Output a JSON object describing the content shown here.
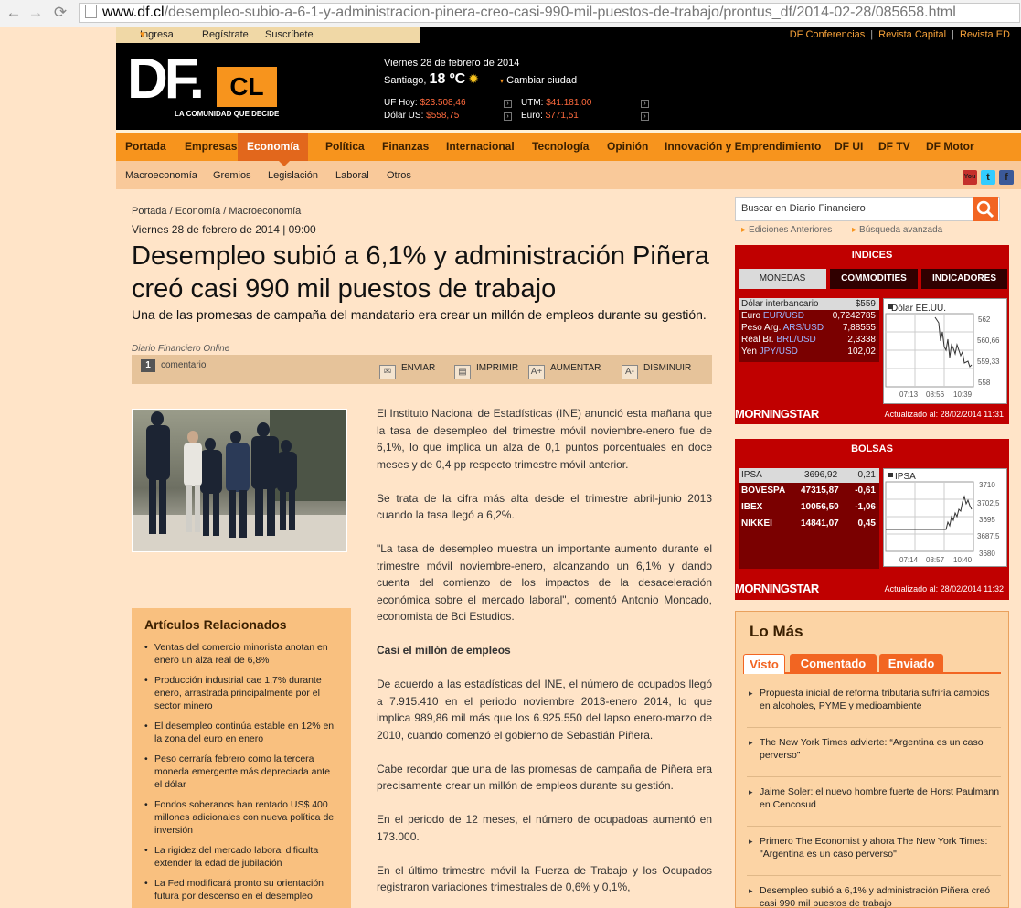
{
  "browser": {
    "url_host": "www.df.cl",
    "url_path": "/desempleo-subio-a-6-1-y-administracion-pinera-creo-casi-990-mil-puestos-de-trabajo/prontus_df/2014-02-28/085658.html"
  },
  "user_links": {
    "login": "Ingresa",
    "register": "Regístrate",
    "subscribe": "Suscríbete"
  },
  "top_links": [
    "DF Conferencias",
    "Revista Capital",
    "Revista ED"
  ],
  "logo": {
    "df": "DF.",
    "cl": "CL",
    "tagline": "LA COMUNIDAD QUE DECIDE"
  },
  "header": {
    "date": "Viernes 28 de febrero de 2014",
    "city": "Santiago,",
    "temp": "18 ºC",
    "change_city": "Cambiar ciudad",
    "uf_label": "UF Hoy:",
    "uf_value": "$23.508,46",
    "dolar_label": "Dólar US:",
    "dolar_value": "$558,75",
    "utm_label": "UTM:",
    "utm_value": "$41.181,00",
    "euro_label": "Euro:",
    "euro_value": "$771,51"
  },
  "nav": {
    "items": [
      "Portada",
      "Empresas",
      "Economía",
      "Política",
      "Finanzas",
      "Internacional",
      "Tecnología",
      "Opinión",
      "Innovación y Emprendimiento",
      "DF UI",
      "DF TV",
      "DF Motor"
    ],
    "active": "Economía"
  },
  "subnav": [
    "Macroeconomía",
    "Gremios",
    "Legislación",
    "Laboral",
    "Otros"
  ],
  "social": {
    "youtube": "You",
    "twitter": "t",
    "facebook": "f"
  },
  "article": {
    "breadcrumb": "Portada / Economía / Macroeconomía",
    "dateline": "Viernes 28 de febrero de 2014 | 09:00",
    "headline": "Desempleo subió a 6,1% y administración Piñera creó casi 990 mil puestos de trabajo",
    "lead": "Una de las promesas de campaña del mandatario era crear un millón de empleos durante su gestión.",
    "source": "Diario Financiero Online",
    "comment_count": "1",
    "comment_label": "comentario",
    "tools": {
      "send": "ENVIAR",
      "print": "IMPRIMIR",
      "bigger": "AUMENTAR",
      "smaller": "DISMINUIR"
    },
    "paragraphs": [
      "El Instituto Nacional de Estadísticas (INE) anunció esta mañana que la tasa de desempleo del trimestre móvil noviembre-enero fue de 6,1%, lo que implica un alza de 0,1 puntos porcentuales en doce meses y de 0,4 pp respecto trimestre móvil anterior.",
      "Se trata de la cifra más alta desde el trimestre abril-junio 2013 cuando la tasa llegó a 6,2%.",
      "\"La tasa de desempleo muestra un importante aumento durante el trimestre móvil noviembre-enero, alcanzando un 6,1% y dando cuenta del comienzo de los impactos de la desaceleración económica sobre el mercado laboral\", comentó Antonio Moncado, economista de Bci Estudios.",
      "Casi el millón de empleos",
      "De acuerdo a las estadísticas del INE, el número de ocupados llegó a 7.915.410 en el periodo noviembre 2013-enero 2014, lo que implica 989,86 mil más que los 6.925.550 del lapso enero-marzo de 2010, cuando comenzó el gobierno de Sebastián Piñera.",
      "Cabe recordar que una de las promesas de campaña de Piñera era precisamente crear un millón de empleos durante su gestión.",
      "En el periodo de 12 meses, el número de ocupadoas aumentó en 173.000.",
      "En el último trimestre móvil la Fuerza de Trabajo y los Ocupados registraron variaciones trimestrales de 0,6% y 0,1%,"
    ]
  },
  "related": {
    "title": "Artículos Relacionados",
    "items": [
      "Ventas del comercio minorista anotan en enero un alza real de 6,8%",
      "Producción industrial cae 1,7% durante enero, arrastrada principalmente por el sector minero",
      "El desempleo continúa estable en 12% en la zona del euro en enero",
      "Peso cerraría febrero como la tercera moneda emergente más depreciada ante el dólar",
      "Fondos soberanos han rentado US$ 400 millones adicionales con nueva política de inversión",
      "La rigidez del mercado laboral dificulta extender la edad de jubilación",
      "La Fed modificará pronto su orientación futura por descenso en el desempleo"
    ]
  },
  "search": {
    "placeholder": "Buscar en Diario Financiero",
    "past": "Ediciones Anteriores",
    "advanced": "Búsqueda avanzada"
  },
  "indices": {
    "title": "INDICES",
    "tabs": [
      "MONEDAS",
      "COMMODITIES",
      "INDICADORES"
    ],
    "rows": [
      {
        "name": "Dólar interbancario",
        "pair": "",
        "value": "$559"
      },
      {
        "name": "Euro",
        "pair": "EUR/USD",
        "value": "0,7242785"
      },
      {
        "name": "Peso Arg.",
        "pair": "ARS/USD",
        "value": "7,88555"
      },
      {
        "name": "Real Br.",
        "pair": "BRL/USD",
        "value": "2,3338"
      },
      {
        "name": "Yen",
        "pair": "JPY/USD",
        "value": "102,02"
      }
    ],
    "chart": {
      "title": "Dólar EE.UU.",
      "y_ticks": [
        "562",
        "560,66",
        "559,33",
        "558"
      ],
      "x_ticks": [
        "07:13",
        "08:56",
        "10:39"
      ]
    },
    "brand": "MORNINGSTAR",
    "updated": "Actualizado al: 28/02/2014 11:31"
  },
  "bolsas": {
    "title": "BOLSAS",
    "rows": [
      {
        "name": "IPSA",
        "value": "3696,92",
        "change": "0,21"
      },
      {
        "name": "BOVESPA",
        "value": "47315,87",
        "change": "-0,61"
      },
      {
        "name": "IBEX",
        "value": "10056,50",
        "change": "-1,06"
      },
      {
        "name": "NIKKEI",
        "value": "14841,07",
        "change": "0,45"
      }
    ],
    "chart": {
      "title": "IPSA",
      "y_ticks": [
        "3710",
        "3702,5",
        "3695",
        "3687,5",
        "3680"
      ],
      "x_ticks": [
        "07:14",
        "08:57",
        "10:40"
      ]
    },
    "brand": "MORNINGSTAR",
    "updated": "Actualizado al: 28/02/2014 11:32"
  },
  "lomas": {
    "title": "Lo Más",
    "tabs": [
      "Visto",
      "Comentado",
      "Enviado"
    ],
    "items": [
      "Propuesta inicial de reforma tributaria sufriría cambios en alcoholes, PYME y medioambiente",
      "The New York Times advierte: “Argentina es un caso perverso”",
      "Jaime Soler: el nuevo hombre fuerte de Horst Paulmann en Cencosud",
      "Primero The Economist y ahora The New York Times: \"Argentina es un caso perverso\"",
      "Desempleo subió a 6,1% y administración Piñera creó casi 990 mil puestos de trabajo"
    ]
  },
  "colors": {
    "orange": "#f7941d",
    "red_box": "#c00000",
    "page_bg": "#ffe4c8"
  }
}
